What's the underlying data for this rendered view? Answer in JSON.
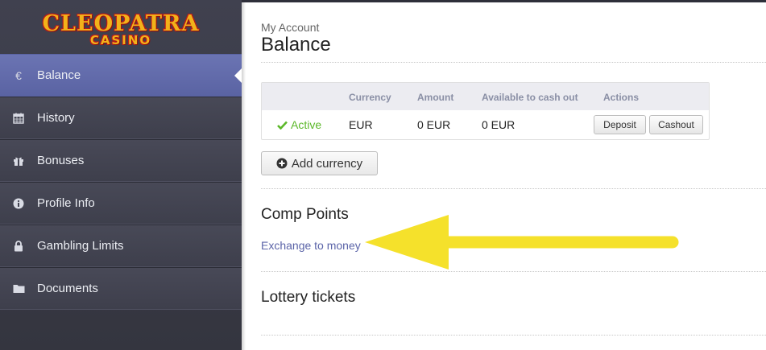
{
  "logo": {
    "main": "CLEOPATRA",
    "sub": "CASINO"
  },
  "sidebar": {
    "items": [
      {
        "label": "Balance",
        "icon": "euro-icon",
        "active": true
      },
      {
        "label": "History",
        "icon": "calendar-icon",
        "active": false
      },
      {
        "label": "Bonuses",
        "icon": "gift-icon",
        "active": false
      },
      {
        "label": "Profile Info",
        "icon": "info-icon",
        "active": false
      },
      {
        "label": "Gambling Limits",
        "icon": "lock-icon",
        "active": false
      },
      {
        "label": "Documents",
        "icon": "folder-icon",
        "active": false
      }
    ]
  },
  "main": {
    "breadcrumb": "My Account",
    "title": "Balance",
    "table": {
      "headers": [
        "Currency",
        "Amount",
        "Available to cash out",
        "Actions"
      ],
      "row": {
        "status": "Active",
        "currency": "EUR",
        "amount": "0 EUR",
        "cashout": "0 EUR",
        "deposit_label": "Deposit",
        "cashout_label": "Cashout"
      }
    },
    "add_currency_label": "Add currency",
    "comp_points": {
      "heading": "Comp Points",
      "link": "Exchange to money"
    },
    "lottery": {
      "heading": "Lottery tickets"
    }
  },
  "colors": {
    "accent": "#5a63a3",
    "status_green": "#5cb82a",
    "annotation_arrow": "#f5e12b",
    "sidebar_bg": "#3e3f4c"
  }
}
